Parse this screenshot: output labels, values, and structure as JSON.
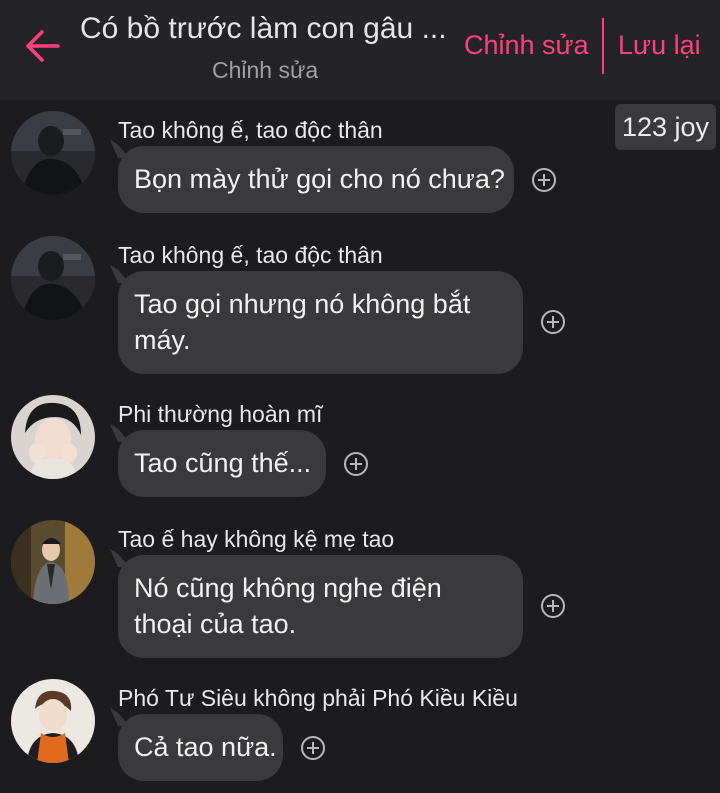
{
  "header": {
    "title": "Có bồ trước làm con gâu ...",
    "subtitle": "Chỉnh sửa",
    "edit_label": "Chỉnh sửa",
    "save_label": "Lưu lại"
  },
  "counter": "123 joy",
  "colors": {
    "accent": "#ff3f7e",
    "background": "#1c1c1e",
    "bubble": "#3a3a3c"
  },
  "messages": [
    {
      "sender": "Tao không ế, tao độc thân",
      "text": "Bọn mày thử gọi cho nó chưa?"
    },
    {
      "sender": "Tao không ế, tao độc thân",
      "text": "Tao gọi nhưng nó không bắt máy."
    },
    {
      "sender": "Phi thường hoàn mĩ",
      "text": "Tao cũng thế..."
    },
    {
      "sender": "Tao ế hay không kệ mẹ tao",
      "text": "Nó cũng không nghe điện thoại của tao."
    },
    {
      "sender": "Phó Tư Siêu không phải Phó Kiều Kiều",
      "text": "Cả tao nữa."
    }
  ],
  "icons": {
    "back": "arrow-left-icon",
    "add": "plus-circle-icon"
  }
}
